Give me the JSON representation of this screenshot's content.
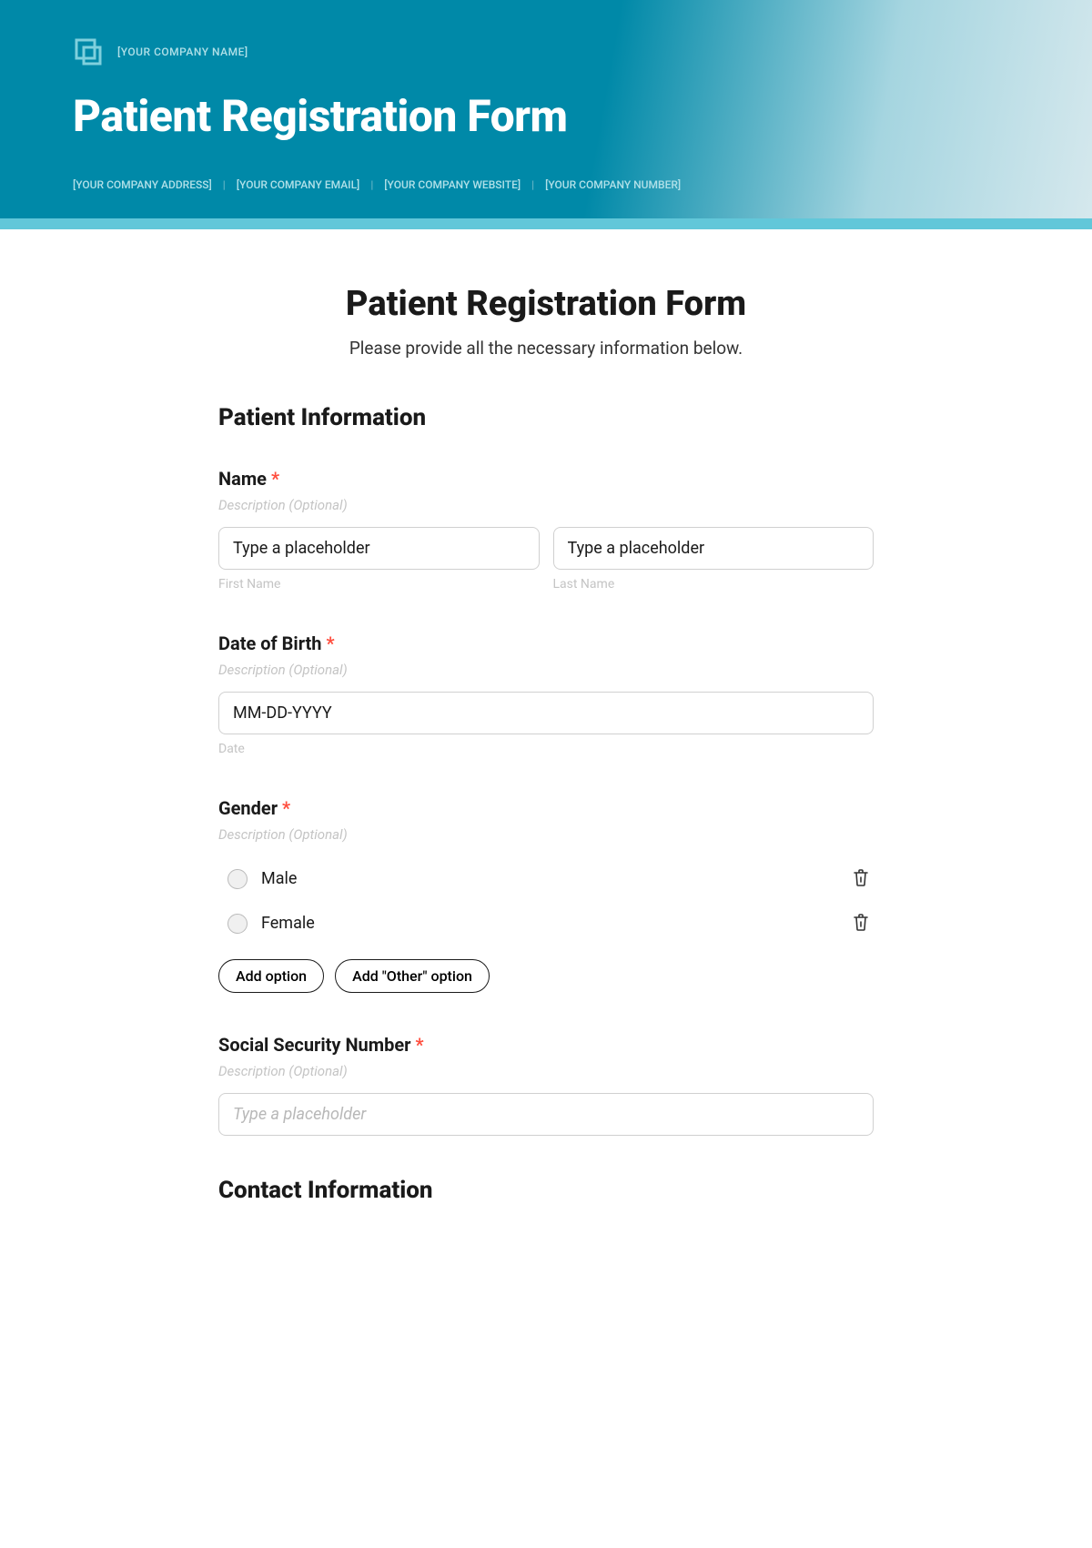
{
  "hero": {
    "company_name": "[YOUR COMPANY NAME]",
    "title": "Patient Registration Form",
    "address": "[YOUR COMPANY ADDRESS]",
    "email": "[YOUR COMPANY EMAIL]",
    "website": "[YOUR COMPANY WEBSITE]",
    "number": "[YOUR COMPANY NUMBER]"
  },
  "form": {
    "title": "Patient Registration Form",
    "subtitle": "Please provide all the necessary information below."
  },
  "sections": {
    "patient_info": "Patient Information",
    "contact_info": "Contact Information"
  },
  "fields": {
    "name": {
      "label": "Name",
      "description": "Description (Optional)",
      "first_placeholder": "Type a placeholder",
      "last_placeholder": "Type a placeholder",
      "first_sublabel": "First Name",
      "last_sublabel": "Last Name"
    },
    "dob": {
      "label": "Date of Birth",
      "description": "Description (Optional)",
      "placeholder": "MM-DD-YYYY",
      "sublabel": "Date"
    },
    "gender": {
      "label": "Gender",
      "description": "Description (Optional)",
      "options": [
        "Male",
        "Female"
      ],
      "add_option": "Add option",
      "add_other": "Add \"Other\" option"
    },
    "ssn": {
      "label": "Social Security Number",
      "description": "Description (Optional)",
      "placeholder": "Type a placeholder"
    }
  }
}
